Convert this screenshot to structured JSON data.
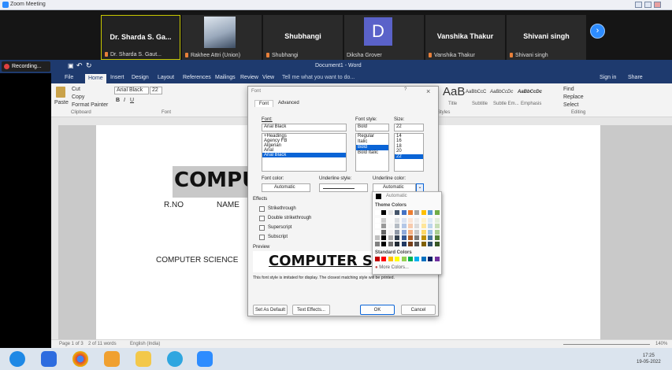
{
  "zoom": {
    "title": "Zoom Meeting",
    "recording_label": "Recording..."
  },
  "participants": [
    {
      "name": "Dr. Sharda S. Ga...",
      "label": "Dr. Sharda S. Gaut..."
    },
    {
      "name": "",
      "label": "Rakhee Attri (Union)"
    },
    {
      "name": "Shubhangi",
      "label": "Shubhangi"
    },
    {
      "name": "D",
      "label": "Diksha Grover"
    },
    {
      "name": "Vanshika Thakur",
      "label": "Vanshika Thakur"
    },
    {
      "name": "Shivani singh",
      "label": "Shivani singh"
    }
  ],
  "word": {
    "doc_title": "Document1 - Word",
    "tabs": [
      "File",
      "Home",
      "Insert",
      "Design",
      "Layout",
      "References",
      "Mailings",
      "Review",
      "View"
    ],
    "tell_me": "Tell me what you want to do...",
    "sign_in": "Sign in",
    "share": "Share",
    "clipboard": {
      "paste": "Paste",
      "cut": "Cut",
      "copy": "Copy",
      "format_painter": "Format Painter",
      "group": "Clipboard"
    },
    "font_group": {
      "font": "Arial Black",
      "size": "22",
      "group": "Font"
    },
    "styles": {
      "samples": [
        "AaB",
        "AaBbCcC",
        "AaBbCcDc",
        "AaBbCcDc"
      ],
      "names": [
        "Title",
        "Subtitle",
        "Subtle Em...",
        "Emphasis"
      ],
      "group": "Styles"
    },
    "editing": {
      "find": "Find",
      "replace": "Replace",
      "select": "Select",
      "group": "Editing"
    },
    "doc_text": {
      "heading": "COMPU",
      "rno": "R.NO",
      "name": "NAME",
      "subject": "COMPUTER SCIENCE"
    },
    "status": {
      "page": "Page 1 of 3",
      "words": "2 of 11 words",
      "lang": "English (India)",
      "zoom": "140%"
    }
  },
  "font_dialog": {
    "title": "Font",
    "tabs": [
      "Font",
      "Advanced"
    ],
    "font_label": "Font:",
    "font_value": "Arial Black",
    "font_list": [
      "+Headings",
      "Agency FB",
      "Algerian",
      "Arial",
      "Arial Black"
    ],
    "style_label": "Font style:",
    "style_value": "Bold",
    "style_list": [
      "Regular",
      "Italic",
      "Bold",
      "Bold Italic"
    ],
    "size_label": "Size:",
    "size_value": "22",
    "size_list": [
      "14",
      "16",
      "18",
      "20",
      "22"
    ],
    "font_color_label": "Font color:",
    "font_color_value": "Automatic",
    "underline_style_label": "Underline style:",
    "underline_color_label": "Underline color:",
    "underline_color_value": "Automatic",
    "effects_label": "Effects",
    "effects": [
      "Strikethrough",
      "Double strikethrough",
      "Superscript",
      "Subscript"
    ],
    "preview_label": "Preview",
    "preview_text": "COMPUTER SC",
    "preview_note": "This font style is imitated for display. The closest matching style will be printed.",
    "set_default": "Set As Default",
    "text_effects": "Text Effects...",
    "ok": "OK",
    "cancel": "Cancel"
  },
  "color_popup": {
    "automatic": "Automatic",
    "theme_colors": "Theme Colors",
    "standard_colors": "Standard Colors",
    "more_colors": "More Colors...",
    "theme_row": [
      "#ffffff",
      "#000000",
      "#e7e6e6",
      "#44546a",
      "#4472c4",
      "#ed7d31",
      "#a5a5a5",
      "#ffc000",
      "#5b9bd5",
      "#70ad47"
    ],
    "standard_row": [
      "#c00000",
      "#ff0000",
      "#ffc000",
      "#ffff00",
      "#92d050",
      "#00b050",
      "#00b0f0",
      "#0070c0",
      "#002060",
      "#7030a0"
    ]
  },
  "taskbar": {
    "time": "17:25",
    "date": "19-05-2022"
  }
}
